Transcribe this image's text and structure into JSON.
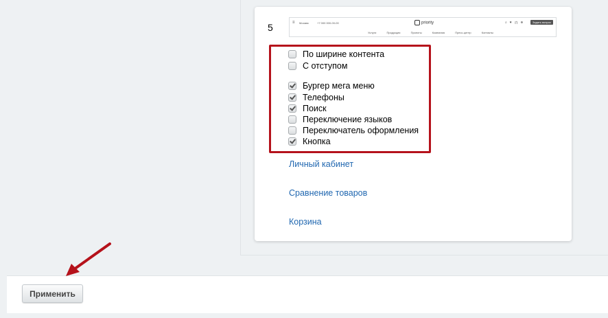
{
  "variant": {
    "number": "5"
  },
  "preview": {
    "city": "Москва",
    "phone": "+7 000 000-00-00",
    "logo": "priority",
    "cta": "Задать вопрос",
    "nav": [
      "Услуги",
      "Продукция",
      "Проекты",
      "Компания",
      "Пресс-центр",
      "Контакты"
    ]
  },
  "options": [
    {
      "label": "По ширине контента",
      "checked": false
    },
    {
      "label": "С отступом",
      "checked": false
    },
    {
      "label": "Бургер мега меню",
      "checked": true
    },
    {
      "label": "Телефоны",
      "checked": true
    },
    {
      "label": "Поиск",
      "checked": true
    },
    {
      "label": "Переключение языков",
      "checked": false
    },
    {
      "label": "Переключатель оформления",
      "checked": false
    },
    {
      "label": "Кнопка",
      "checked": true
    }
  ],
  "links": {
    "cabinet": "Личный кабинет",
    "compare": "Сравнение товаров",
    "cart": "Корзина"
  },
  "footer": {
    "apply_label": "Применить"
  },
  "colors": {
    "highlight": "#b5121b",
    "link": "#2067b0",
    "arrow": "#b5121b"
  }
}
